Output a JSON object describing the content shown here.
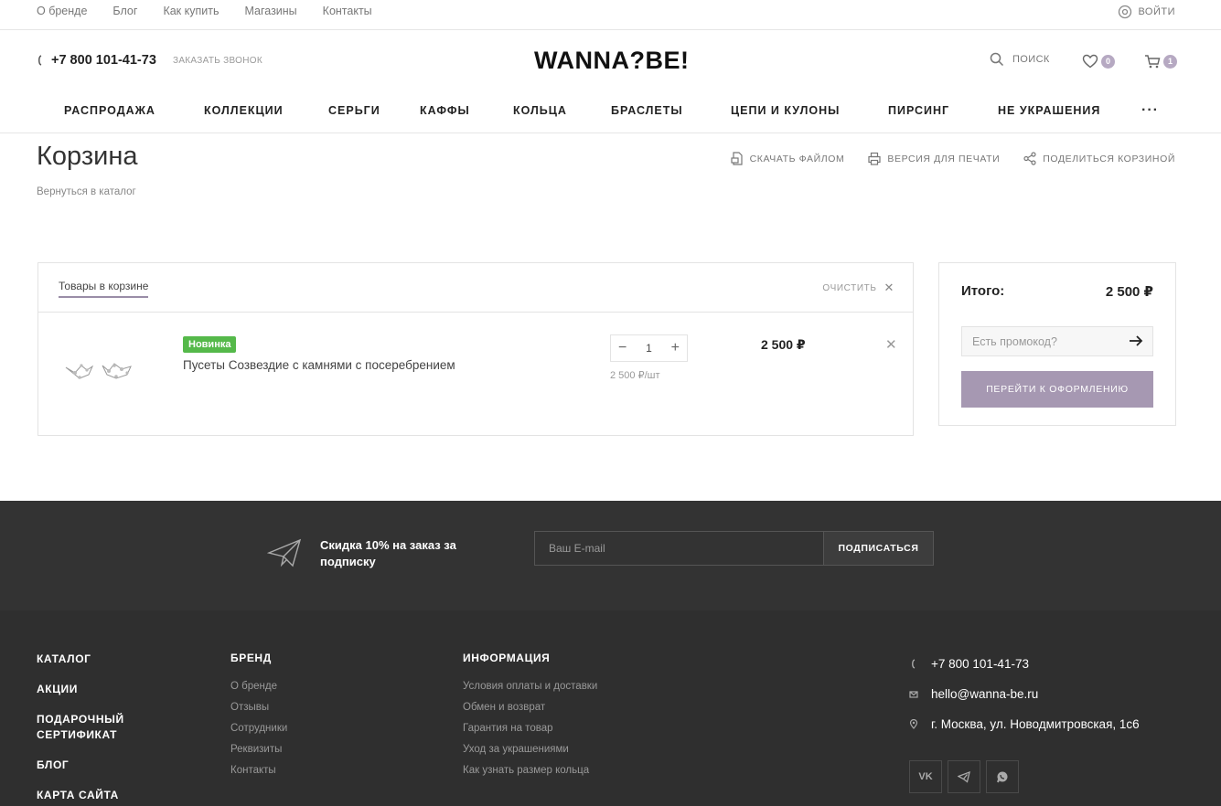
{
  "topnav": {
    "links": [
      "О бренде",
      "Блог",
      "Как купить",
      "Магазины",
      "Контакты"
    ],
    "login_label": "ВОЙТИ"
  },
  "header": {
    "phone": "+7 800 101-41-73",
    "callback_label": "ЗАКАЗАТЬ ЗВОНОК",
    "logo": "WANNA?BE!",
    "search_label": "ПОИСК",
    "favorites_count": "0",
    "cart_count": "1"
  },
  "mainnav": {
    "items": [
      "РАСПРОДАЖА",
      "КОЛЛЕКЦИИ",
      "СЕРЬГИ",
      "КАФФЫ",
      "КОЛЬЦА",
      "БРАСЛЕТЫ",
      "ЦЕПИ И КУЛОНЫ",
      "ПИРСИНГ",
      "НЕ УКРАШЕНИЯ"
    ],
    "more_label": "···"
  },
  "page": {
    "title": "Корзина",
    "back_link": "Вернуться в каталог",
    "actions": {
      "download": "СКАЧАТЬ ФАЙЛОМ",
      "print": "ВЕРСИЯ ДЛЯ ПЕЧАТИ",
      "share": "ПОДЕЛИТЬСЯ КОРЗИНОЙ"
    }
  },
  "cart": {
    "tab_label": "Товары в корзине",
    "clear_label": "ОЧИСТИТЬ",
    "items": [
      {
        "badge": "Новинка",
        "name": "Пусеты Созвездие с камнями с посеребрением",
        "quantity": "1",
        "unit_price": "2 500 ₽/шт",
        "price": "2 500 ₽"
      }
    ]
  },
  "summary": {
    "total_label": "Итого:",
    "total_value": "2 500 ₽",
    "promo_placeholder": "Есть промокод?",
    "checkout_label": "ПЕРЕЙТИ К ОФОРМЛЕНИЮ"
  },
  "subscribe": {
    "text": "Скидка 10% на заказ за подписку",
    "email_placeholder": "Ваш E-mail",
    "button_label": "ПОДПИСАТЬСЯ"
  },
  "footer": {
    "main_links": [
      "КАТАЛОГ",
      "АКЦИИ",
      "ПОДАРОЧНЫЙ СЕРТИФИКАТ",
      "БЛОГ",
      "КАРТА САЙТА"
    ],
    "brand": {
      "heading": "БРЕНД",
      "links": [
        "О бренде",
        "Отзывы",
        "Сотрудники",
        "Реквизиты",
        "Контакты"
      ]
    },
    "info": {
      "heading": "ИНФОРМАЦИЯ",
      "links": [
        "Условия оплаты и доставки",
        "Обмен и возврат",
        "Гарантия на товар",
        "Уход за украшениями",
        "Как узнать размер кольца"
      ]
    },
    "contacts": {
      "phone": "+7 800 101-41-73",
      "email": "hello@wanna-be.ru",
      "address": "г. Москва, ул. Новодмитровская, 1с6"
    },
    "socials": [
      "vk-icon",
      "telegram-icon",
      "whatsapp-icon"
    ]
  },
  "colors": {
    "accent": "#a698b2",
    "badge_new": "#55b94a",
    "footer_bg": "#2f2f2f"
  }
}
